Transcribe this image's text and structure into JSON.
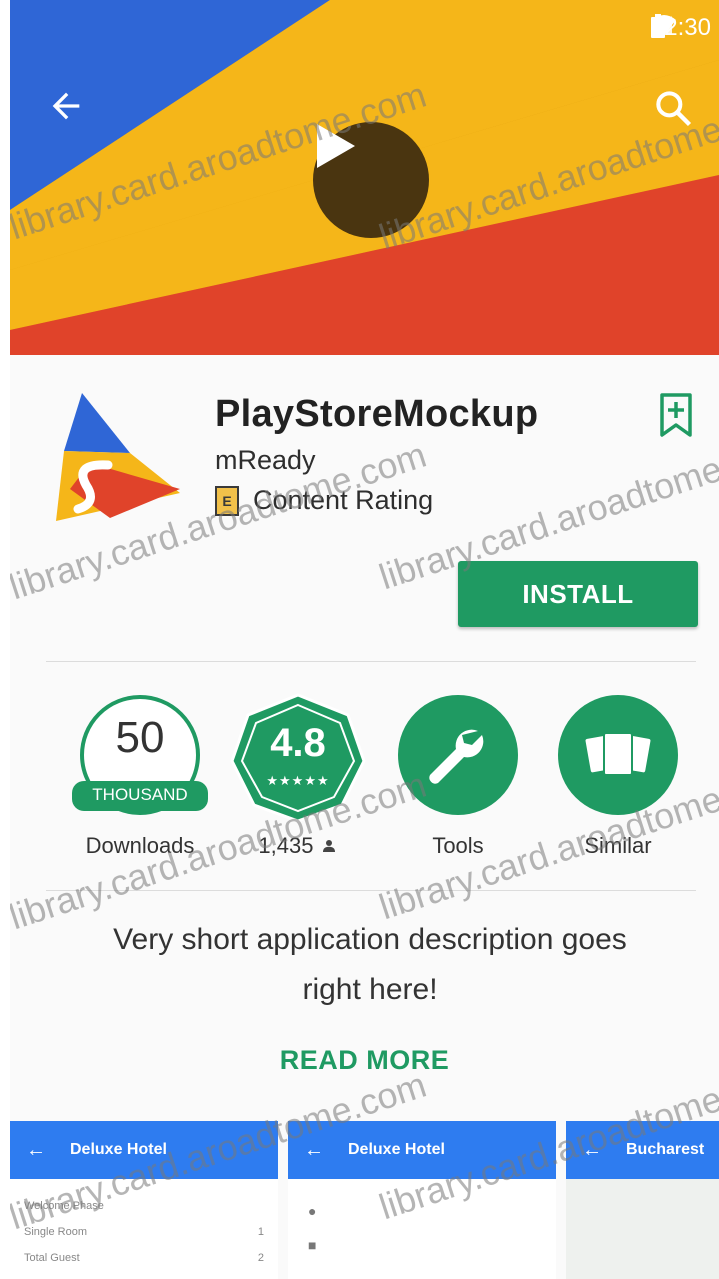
{
  "status_bar": {
    "time": "12:30",
    "icons": [
      "wifi-icon",
      "signal-icon",
      "battery-icon"
    ]
  },
  "hero": {
    "colors": [
      "#2f66d6",
      "#f5b619",
      "#e3a30f",
      "#e0432a"
    ]
  },
  "app": {
    "title": "PlayStoreMockup",
    "developer": "mReady",
    "content_rating_label": "Content Rating",
    "content_rating_badge": "E",
    "install_label": "INSTALL"
  },
  "stats": {
    "downloads_value": "50",
    "downloads_unit": "THOUSAND",
    "downloads_label": "Downloads",
    "rating_value": "4.8",
    "rating_stars": "★★★★★",
    "rating_count": "1,435",
    "category_label": "Tools",
    "similar_label": "Similar"
  },
  "description": {
    "text": "Very short application description goes right here!",
    "read_more": "READ MORE"
  },
  "screenshots": [
    {
      "title": "Deluxe Hotel",
      "rows": [
        [
          "Welcome Phase",
          ""
        ],
        [
          "Single Room",
          "1"
        ],
        [
          "Total Guest",
          "2"
        ]
      ]
    },
    {
      "title": "Deluxe Hotel",
      "rows": [
        [
          "",
          ""
        ],
        [
          "",
          ""
        ]
      ]
    },
    {
      "title": "Bucharest",
      "rows": []
    }
  ],
  "watermark": "library.card.aroadtome.com",
  "accent_color": "#1f9a62"
}
